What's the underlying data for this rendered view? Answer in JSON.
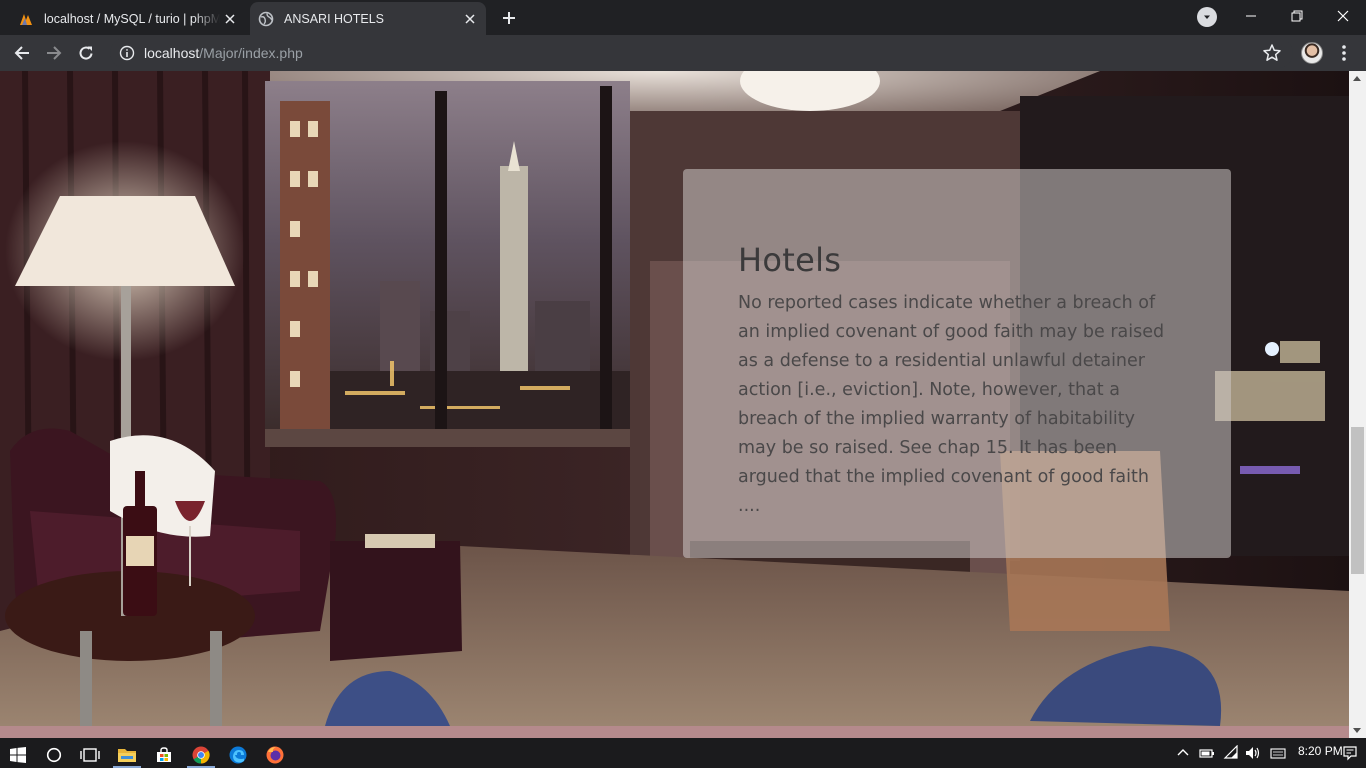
{
  "browser": {
    "tabs": [
      {
        "title": "localhost / MySQL / turio | phpMyAdmin",
        "active": false,
        "icon": "phpmyadmin-icon"
      },
      {
        "title": "ANSARI HOTELS",
        "active": true,
        "icon": "globe-icon"
      }
    ],
    "url_host": "localhost",
    "url_path": "/Major/index.php"
  },
  "page": {
    "card_title": "Hotels",
    "card_text": "No reported cases indicate whether a breach of an implied covenant of good faith may be raised as a defense to a residential unlawful detainer action [i.e., eviction]. Note, however, that a breach of the implied warranty of habitability may be so raised. See chap 15. It has been argued that the implied covenant of good faith ...."
  },
  "taskbar": {
    "time": "8:20 PM",
    "apps": [
      "start-icon",
      "search-icon",
      "task-view-icon",
      "file-explorer-icon",
      "store-icon",
      "chrome-icon",
      "edge-icon",
      "firefox-icon"
    ]
  },
  "colors": {
    "chrome_dark": "#202124",
    "chrome_toolbar": "#35363a",
    "card_bg": "rgba(205,200,198,0.55)",
    "strip": "#b58a8c"
  }
}
